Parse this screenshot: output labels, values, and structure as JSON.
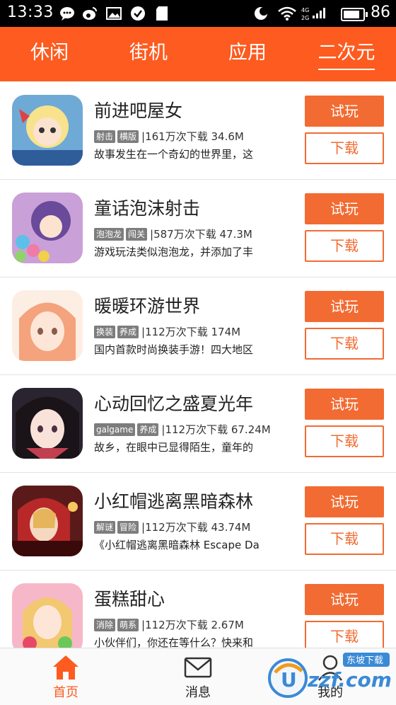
{
  "status_bar": {
    "time": "13:33",
    "battery_level": "86"
  },
  "tabs": [
    {
      "label": "休闲",
      "active": false
    },
    {
      "label": "街机",
      "active": false
    },
    {
      "label": "应用",
      "active": false
    },
    {
      "label": "二次元",
      "active": true
    }
  ],
  "apps": [
    {
      "title": "前进吧屋女",
      "tags": [
        "射击",
        "横版"
      ],
      "stats": "161万次下载 34.6M",
      "desc": "故事发生在一个奇幻的世界里，这",
      "try_label": "试玩",
      "download_label": "下载"
    },
    {
      "title": "童话泡沫射击",
      "tags": [
        "泡泡龙",
        "闯关"
      ],
      "stats": "587万次下载 47.3M",
      "desc": "游戏玩法类似泡泡龙，并添加了丰",
      "try_label": "试玩",
      "download_label": "下载"
    },
    {
      "title": "暖暖环游世界",
      "tags": [
        "换装",
        "养成"
      ],
      "stats": "112万次下载 174M",
      "desc": "国内首款时尚换装手游！四大地区",
      "try_label": "试玩",
      "download_label": "下载"
    },
    {
      "title": "心动回忆之盛夏光年",
      "tags": [
        "galgame",
        "养成"
      ],
      "stats": "112万次下载 67.24M",
      "desc": "故乡，在眼中已显得陌生，童年的",
      "try_label": "试玩",
      "download_label": "下载"
    },
    {
      "title": "小红帽逃离黑暗森林",
      "tags": [
        "解谜",
        "冒险"
      ],
      "stats": "112万次下载 43.74M",
      "desc": "《小红帽逃离黑暗森林 Escape Da",
      "try_label": "试玩",
      "download_label": "下载"
    },
    {
      "title": "蛋糕甜心",
      "tags": [
        "消除",
        "萌系"
      ],
      "stats": "112万次下载 2.67M",
      "desc": "小伙伴们，你还在等什么？快来和",
      "try_label": "试玩",
      "download_label": "下载"
    }
  ],
  "bottom_nav": [
    {
      "label": "首页",
      "icon": "home-icon",
      "active": true
    },
    {
      "label": "消息",
      "icon": "mail-icon",
      "active": false
    },
    {
      "label": "我的",
      "icon": "user-icon",
      "active": false
    }
  ],
  "watermark": {
    "text": "uzzf.com",
    "badge": "东坡下载"
  },
  "colors": {
    "brand_orange": "#fd5b1f",
    "button_orange": "#f26b32",
    "tag_gray": "#7d7d7d"
  }
}
